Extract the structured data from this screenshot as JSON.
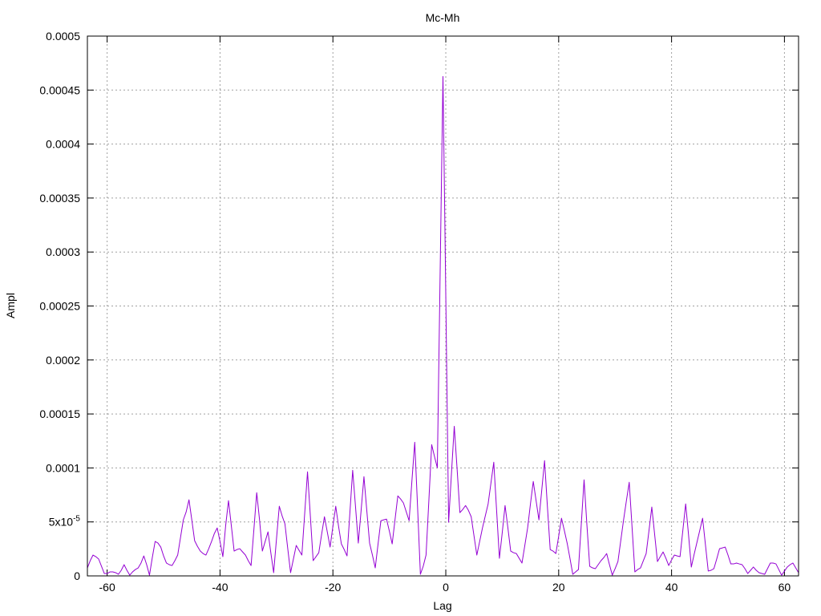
{
  "chart_data": {
    "type": "line",
    "title": "Mc-Mh",
    "xlabel": "Lag",
    "ylabel": "Ampl",
    "xlim": [
      -63.5,
      62.5
    ],
    "ylim": [
      0,
      0.0005
    ],
    "grid": true,
    "x_ticks": [
      {
        "value": -60,
        "label": "-60"
      },
      {
        "value": -40,
        "label": "-40"
      },
      {
        "value": -20,
        "label": "-20"
      },
      {
        "value": 0,
        "label": "0"
      },
      {
        "value": 20,
        "label": "20"
      },
      {
        "value": 40,
        "label": "40"
      },
      {
        "value": 60,
        "label": "60"
      }
    ],
    "y_ticks": [
      {
        "value": 0,
        "label": "0"
      },
      {
        "value": 5e-05,
        "label": "5x10",
        "sup": "-5"
      },
      {
        "value": 0.0001,
        "label": "0.0001"
      },
      {
        "value": 0.00015,
        "label": "0.00015"
      },
      {
        "value": 0.0002,
        "label": "0.0002"
      },
      {
        "value": 0.00025,
        "label": "0.00025"
      },
      {
        "value": 0.0003,
        "label": "0.0003"
      },
      {
        "value": 0.00035,
        "label": "0.00035"
      },
      {
        "value": 0.0004,
        "label": "0.0004"
      },
      {
        "value": 0.00045,
        "label": "0.00045"
      },
      {
        "value": 0.0005,
        "label": "0.0005"
      }
    ],
    "series": [
      {
        "color": "#9400D3",
        "x": [
          -63.5,
          -63,
          -62.5,
          -62,
          -61.5,
          -61,
          -60.5,
          -60,
          -59.5,
          -59,
          -58.5,
          -58,
          -57.5,
          -57,
          -56.5,
          -56,
          -55.5,
          -55,
          -54.5,
          -54,
          -53.5,
          -53,
          -52.5,
          -52,
          -51.5,
          -51,
          -50.5,
          -50,
          -49.5,
          -49,
          -48.5,
          -48,
          -47.5,
          -47,
          -46.5,
          -46,
          -45.5,
          -45,
          -44.5,
          -44,
          -43.5,
          -43,
          -42.5,
          -42,
          -41.5,
          -41,
          -40.5,
          -40,
          -39.5,
          -39,
          -38.5,
          -38,
          -37.5,
          -37,
          -36.5,
          -36,
          -35.5,
          -35,
          -34.5,
          -34,
          -33.5,
          -33,
          -32.5,
          -32,
          -31.5,
          -31,
          -30.5,
          -30,
          -29.5,
          -29,
          -28.5,
          -28,
          -27.5,
          -27,
          -26.5,
          -26,
          -25.5,
          -25,
          -24.5,
          -24,
          -23.5,
          -23,
          -22.5,
          -22,
          -21.5,
          -21,
          -20.5,
          -20,
          -19.5,
          -19,
          -18.5,
          -18,
          -17.5,
          -17,
          -16.5,
          -16,
          -15.5,
          -15,
          -14.5,
          -14,
          -13.5,
          -13,
          -12.5,
          -12,
          -11.5,
          -11,
          -10.5,
          -10,
          -9.5,
          -9,
          -8.5,
          -8,
          -7.5,
          -7,
          -6.5,
          -6,
          -5.5,
          -5,
          -4.5,
          -4,
          -3.5,
          -3,
          -2.5,
          -2,
          -1.5,
          -1,
          -0.5,
          0,
          0.5,
          1,
          1.5,
          2,
          2.5,
          3,
          3.5,
          4,
          4.5,
          5,
          5.5,
          6,
          6.5,
          7,
          7.5,
          8,
          8.5,
          9,
          9.5,
          10,
          10.5,
          11,
          11.5,
          12,
          12.5,
          13,
          13.5,
          14,
          14.5,
          15,
          15.5,
          16,
          16.5,
          17,
          17.5,
          18,
          18.5,
          19,
          19.5,
          20,
          20.5,
          21,
          21.5,
          22,
          22.5,
          23,
          23.5,
          24,
          24.5,
          25,
          25.5,
          26,
          26.5,
          27,
          27.5,
          28,
          28.5,
          29,
          29.5,
          30,
          30.5,
          31,
          31.5,
          32,
          32.5,
          33,
          33.5,
          34,
          34.5,
          35,
          35.5,
          36,
          36.5,
          37,
          37.5,
          38,
          38.5,
          39,
          39.5,
          40,
          40.5,
          41,
          41.5,
          42,
          42.5,
          43,
          43.5,
          44,
          44.5,
          45,
          45.5,
          46,
          46.5,
          47,
          47.5,
          48,
          48.5,
          49,
          49.5,
          50,
          50.5,
          51,
          51.5,
          52,
          52.5,
          53,
          53.5,
          54,
          54.5,
          55,
          55.5,
          56,
          56.5,
          57,
          57.5,
          58,
          58.5,
          59,
          59.5,
          60,
          60.5,
          61,
          61.5,
          62,
          62.5
        ],
        "y": [
          7.4e-06,
          1.41e-05,
          1.93e-05,
          1.78e-05,
          1.56e-05,
          8.9e-06,
          2.2e-06,
          2.2e-06,
          3.7e-06,
          3.7e-06,
          3e-06,
          1.5e-06,
          5.2e-06,
          1.04e-05,
          5.2e-06,
          7e-07,
          3.7e-06,
          5.9e-06,
          7.4e-06,
          1.19e-05,
          1.85e-05,
          1.04e-05,
          7e-07,
          1.7e-05,
          3.19e-05,
          3.04e-05,
          2.67e-05,
          1.85e-05,
          1.19e-05,
          1.04e-05,
          9.6e-06,
          1.41e-05,
          1.93e-05,
          3.56e-05,
          5.19e-05,
          5.93e-05,
          7.05e-05,
          5.19e-05,
          3.26e-05,
          2.74e-05,
          2.3e-05,
          2.07e-05,
          1.93e-05,
          2.52e-05,
          3.19e-05,
          3.93e-05,
          4.44e-05,
          3.19e-05,
          1.78e-05,
          4.67e-05,
          6.97e-05,
          4.67e-05,
          2.3e-05,
          2.44e-05,
          2.52e-05,
          2.22e-05,
          1.93e-05,
          1.41e-05,
          9.6e-06,
          4.3e-05,
          7.71e-05,
          5.19e-05,
          2.3e-05,
          3.19e-05,
          4.08e-05,
          2.15e-05,
          3e-06,
          3.41e-05,
          6.45e-05,
          5.56e-05,
          4.82e-05,
          2.52e-05,
          3e-06,
          1.56e-05,
          2.82e-05,
          2.37e-05,
          1.93e-05,
          5.78e-05,
          9.64e-05,
          5.56e-05,
          1.41e-05,
          1.78e-05,
          2.15e-05,
          3.85e-05,
          5.48e-05,
          4.08e-05,
          2.67e-05,
          4.59e-05,
          6.45e-05,
          4.59e-05,
          2.96e-05,
          2.44e-05,
          1.85e-05,
          5.78e-05,
          9.79e-05,
          6.45e-05,
          3.04e-05,
          6.08e-05,
          9.19e-05,
          6.08e-05,
          3.04e-05,
          1.93e-05,
          7.4e-06,
          2.96e-05,
          5.11e-05,
          5.19e-05,
          5.26e-05,
          4.15e-05,
          2.96e-05,
          5.19e-05,
          7.41e-05,
          7.12e-05,
          6.75e-05,
          5.93e-05,
          5.11e-05,
          8.82e-05,
          0.0001238,
          6.38e-05,
          1.5e-06,
          8.9e-06,
          1.93e-05,
          6.97e-05,
          0.0001216,
          0.0001105,
          0.0001001,
          0.0002817,
          0.0004626,
          0.0002594,
          4.97e-05,
          9.45e-05,
          0.0001386,
          9.93e-05,
          5.86e-05,
          6.15e-05,
          6.52e-05,
          6.08e-05,
          5.48e-05,
          3.7e-05,
          1.93e-05,
          3.19e-05,
          4.45e-05,
          5.56e-05,
          6.67e-05,
          8.6e-05,
          0.0001053,
          6.08e-05,
          1.63e-05,
          4e-05,
          6.52e-05,
          4.45e-05,
          2.3e-05,
          2.15e-05,
          2.07e-05,
          1.63e-05,
          1.19e-05,
          2.82e-05,
          4.45e-05,
          6.67e-05,
          8.75e-05,
          6.97e-05,
          5.19e-05,
          7.93e-05,
          0.0001068,
          6.45e-05,
          2.44e-05,
          2.3e-05,
          2.07e-05,
          3.67e-05,
          5.34e-05,
          4.22e-05,
          3.04e-05,
          1.63e-05,
          1.5e-06,
          3.7e-06,
          5.9e-06,
          4.74e-05,
          8.9e-05,
          4.74e-05,
          8.9e-06,
          7.4e-06,
          6.7e-06,
          1.04e-05,
          1.41e-05,
          1.7e-05,
          2.07e-05,
          1.04e-05,
          7e-07,
          6.7e-06,
          1.33e-05,
          3.26e-05,
          5.19e-05,
          6.97e-05,
          8.67e-05,
          4.52e-05,
          3.7e-06,
          5.9e-06,
          7.4e-06,
          1.41e-05,
          2.07e-05,
          4.19e-05,
          6.38e-05,
          3.85e-05,
          1.33e-05,
          1.78e-05,
          2.22e-05,
          1.63e-05,
          9.6e-06,
          1.48e-05,
          1.93e-05,
          1.85e-05,
          1.78e-05,
          4.22e-05,
          6.67e-05,
          3.85e-05,
          8.2e-06,
          2e-05,
          3.11e-05,
          4.22e-05,
          5.34e-05,
          2.89e-05,
          4.5e-06,
          5.2e-06,
          6.7e-06,
          1.56e-05,
          2.52e-05,
          2.59e-05,
          2.67e-05,
          1.93e-05,
          1.11e-05,
          1.11e-05,
          1.19e-05,
          1.11e-05,
          1.04e-05,
          6.7e-06,
          2.2e-06,
          5.2e-06,
          8.2e-06,
          5.2e-06,
          3e-06,
          2.2e-06,
          1.5e-06,
          6.7e-06,
          1.19e-05,
          1.19e-05,
          1.11e-05,
          5.9e-06,
          7e-07,
          4.4e-06,
          8.2e-06,
          1.04e-05,
          1.19e-05,
          7.4e-06,
          3e-06
        ]
      }
    ]
  }
}
